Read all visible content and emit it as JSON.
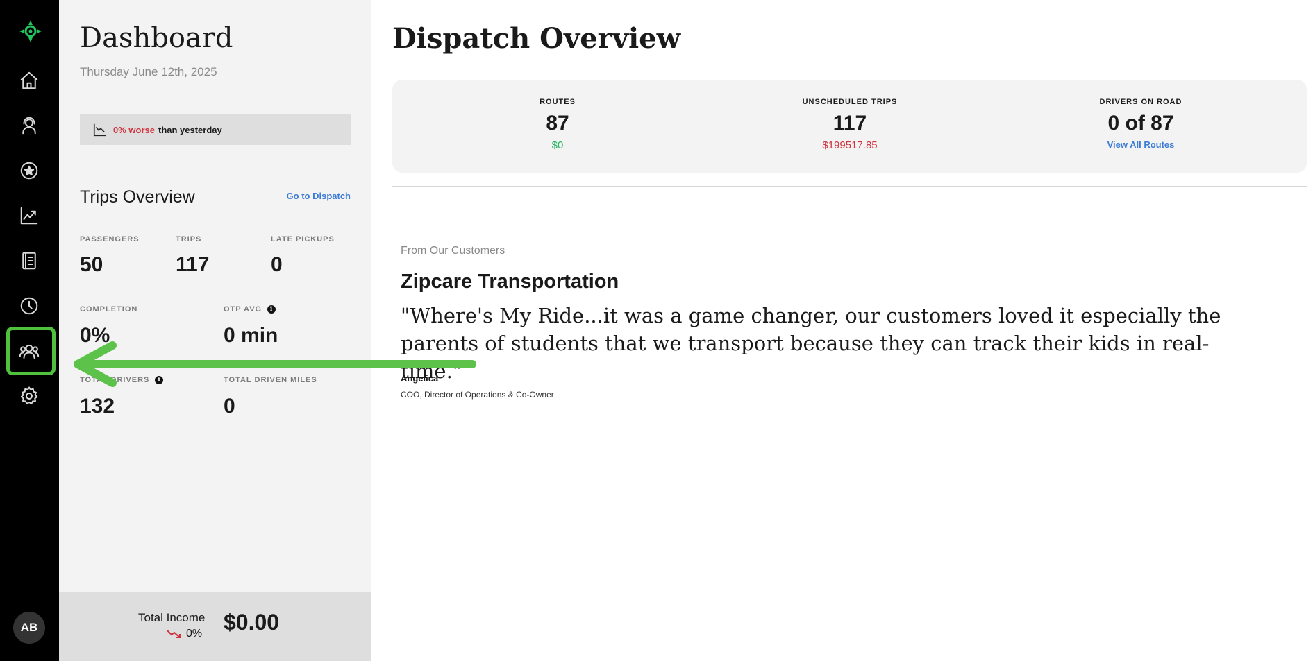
{
  "sidebar": {
    "logo_icon": "crosshair-logo-icon",
    "items": [
      {
        "name": "home",
        "icon": "home-icon"
      },
      {
        "name": "dispatch",
        "icon": "headset-icon"
      },
      {
        "name": "favorites",
        "icon": "star-icon"
      },
      {
        "name": "reports",
        "icon": "chart-line-icon"
      },
      {
        "name": "logs",
        "icon": "book-icon"
      },
      {
        "name": "history",
        "icon": "clock-icon"
      },
      {
        "name": "users",
        "icon": "users-icon",
        "highlighted": true
      },
      {
        "name": "settings",
        "icon": "gear-icon"
      }
    ],
    "avatar_initials": "AB",
    "highlight_color": "#4fc13c"
  },
  "left": {
    "title": "Dashboard",
    "date": "Thursday June 12th, 2025",
    "compare": {
      "worse_text": "0% worse",
      "rest_text": "than yesterday"
    },
    "trips_title": "Trips Overview",
    "goto_link": "Go to Dispatch",
    "stats": {
      "passengers": {
        "label": "PASSENGERS",
        "value": "50"
      },
      "trips": {
        "label": "TRIPS",
        "value": "117"
      },
      "late_pickups": {
        "label": "LATE PICKUPS",
        "value": "0"
      },
      "completion": {
        "label": "COMPLETION",
        "value": "0%"
      },
      "otp_avg": {
        "label": "OTP AVG",
        "value": "0 min"
      },
      "total_drivers": {
        "label": "TOTAL DRIVERS",
        "value": "132"
      },
      "total_driven_miles": {
        "label": "TOTAL DRIVEN MILES",
        "value": "0"
      }
    },
    "income": {
      "label": "Total Income",
      "pct": "0%",
      "value": "$0.00"
    }
  },
  "main": {
    "title": "Dispatch Overview",
    "kpis": {
      "routes": {
        "label": "ROUTES",
        "value": "87",
        "sub": "$0"
      },
      "unscheduled": {
        "label": "UNSCHEDULED TRIPS",
        "value": "117",
        "sub": "$199517.85"
      },
      "drivers": {
        "label": "DRIVERS ON ROAD",
        "value": "0 of 87",
        "link": "View All Routes"
      }
    },
    "testimonial": {
      "from_label": "From Our Customers",
      "company": "Zipcare Transportation",
      "quote": "\"Where's My Ride...it was a game changer, our customers loved it especially the parents of students that we transport because they can track their kids in real-time.\"",
      "author": "Angelica",
      "role": "COO, Director of Operations & Co-Owner"
    }
  },
  "colors": {
    "accent_green": "#4fc13c",
    "negative_red": "#d0333d",
    "positive_green": "#22b35e",
    "link_blue": "#3a7bd5"
  }
}
